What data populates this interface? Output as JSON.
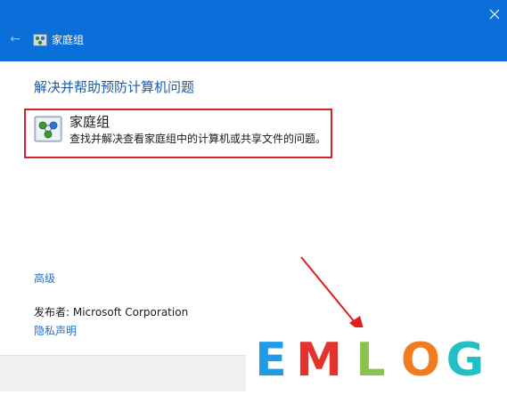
{
  "window": {
    "title": "家庭组",
    "title_icon": "homegroup-icon",
    "back_icon": "back-arrow-icon",
    "close_icon": "close-icon"
  },
  "main": {
    "heading": "解决并帮助预防计算机问题",
    "troubleshooter": {
      "icon": "homegroup-icon",
      "title": "家庭组",
      "description": "查找并解决查看家庭组中的计算机或共享文件的问题。"
    },
    "advanced_link": "高级",
    "publisher": "发布者:  Microsoft Corporation",
    "privacy_link": "隐私声明"
  },
  "watermark": {
    "text": "EMLOG",
    "letter_colors": [
      "#1f9be8",
      "#e4332c",
      "#8bc34a",
      "#f07c1f",
      "#23bfc6"
    ]
  },
  "colors": {
    "titlebar": "#0a6fd8",
    "heading": "#1d5aa6",
    "link": "#1f6fc9",
    "highlight": "#d9232b"
  }
}
